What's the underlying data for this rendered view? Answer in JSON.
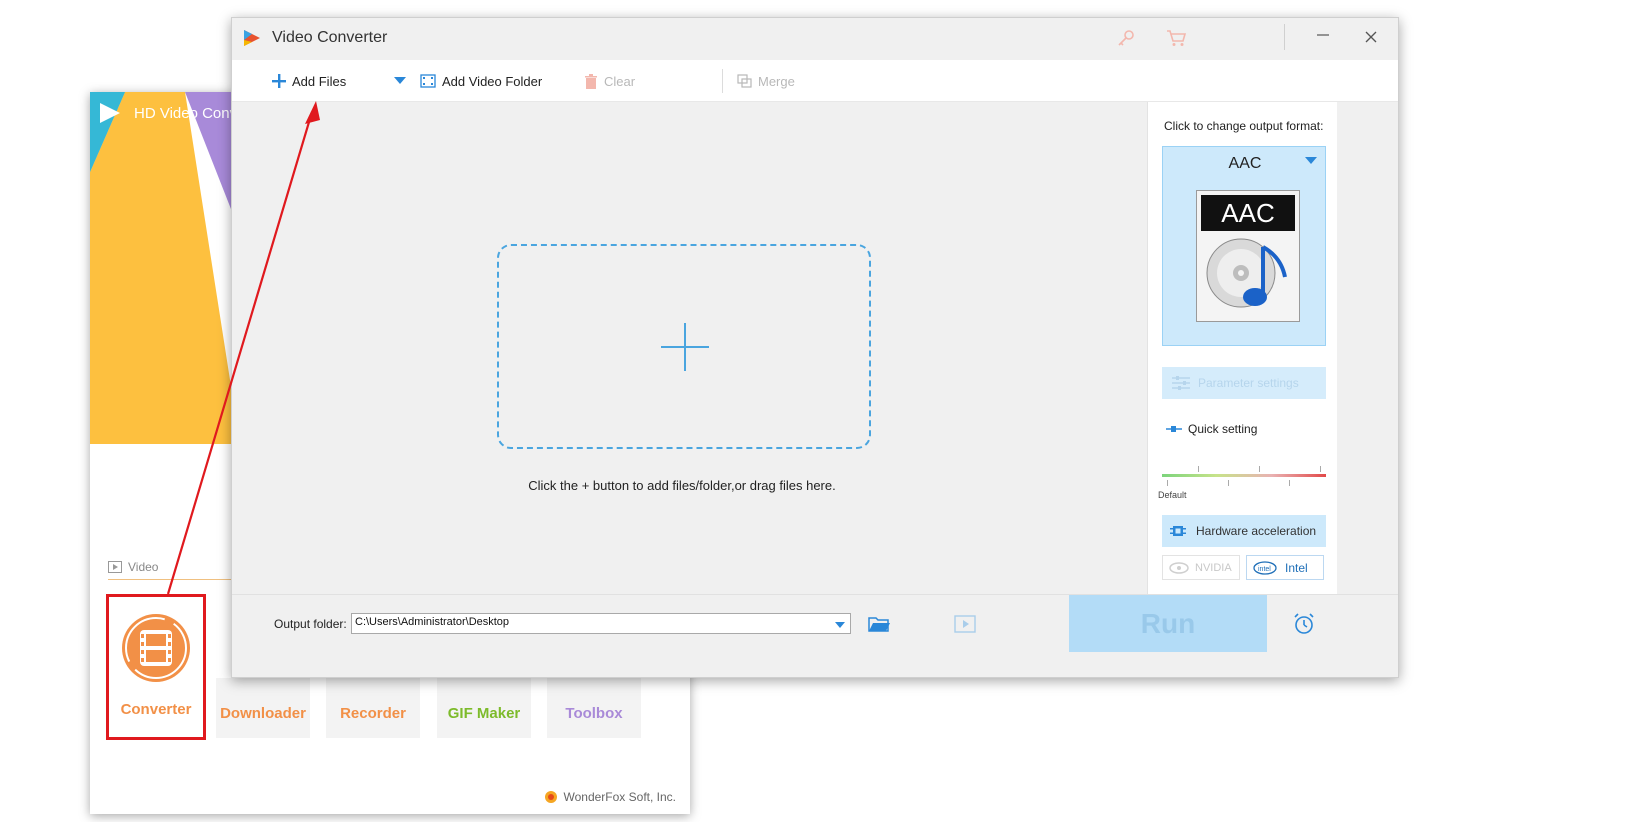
{
  "background_window": {
    "title": "HD Video Conv",
    "section_label": "Video",
    "tiles": [
      {
        "label": "Converter",
        "color": "#f29047"
      },
      {
        "label": "Downloader",
        "color": "#f29047"
      },
      {
        "label": "Recorder",
        "color": "#f29047"
      },
      {
        "label": "GIF Maker",
        "color": "#7dbb2b"
      },
      {
        "label": "Toolbox",
        "color": "#a98ad8"
      }
    ],
    "footer": "WonderFox Soft, Inc."
  },
  "main_window": {
    "title": "Video Converter",
    "icons": {
      "key": "key-icon",
      "cart": "cart-icon",
      "minimize": "minimize-icon",
      "close": "close-icon"
    },
    "toolbar": {
      "add_files": "Add Files",
      "add_video_folder": "Add Video Folder",
      "clear": "Clear",
      "merge": "Merge"
    },
    "drop_hint": "Click the + button to add files/folder,or drag files here.",
    "right_panel": {
      "change_format_label": "Click to change output format:",
      "format": "AAC",
      "format_badge": "AAC",
      "parameter_settings": "Parameter settings",
      "quick_setting": "Quick setting",
      "slider_label": "Default",
      "hardware_acceleration": "Hardware acceleration",
      "nvidia": "NVIDIA",
      "intel": "Intel"
    },
    "bottom_bar": {
      "output_folder_label": "Output folder:",
      "output_path": "C:\\Users\\Administrator\\Desktop",
      "run": "Run"
    }
  },
  "colors": {
    "accent_blue": "#4aa5df",
    "highlight_red": "#e0191e",
    "run_button": "#b3dcf7"
  }
}
